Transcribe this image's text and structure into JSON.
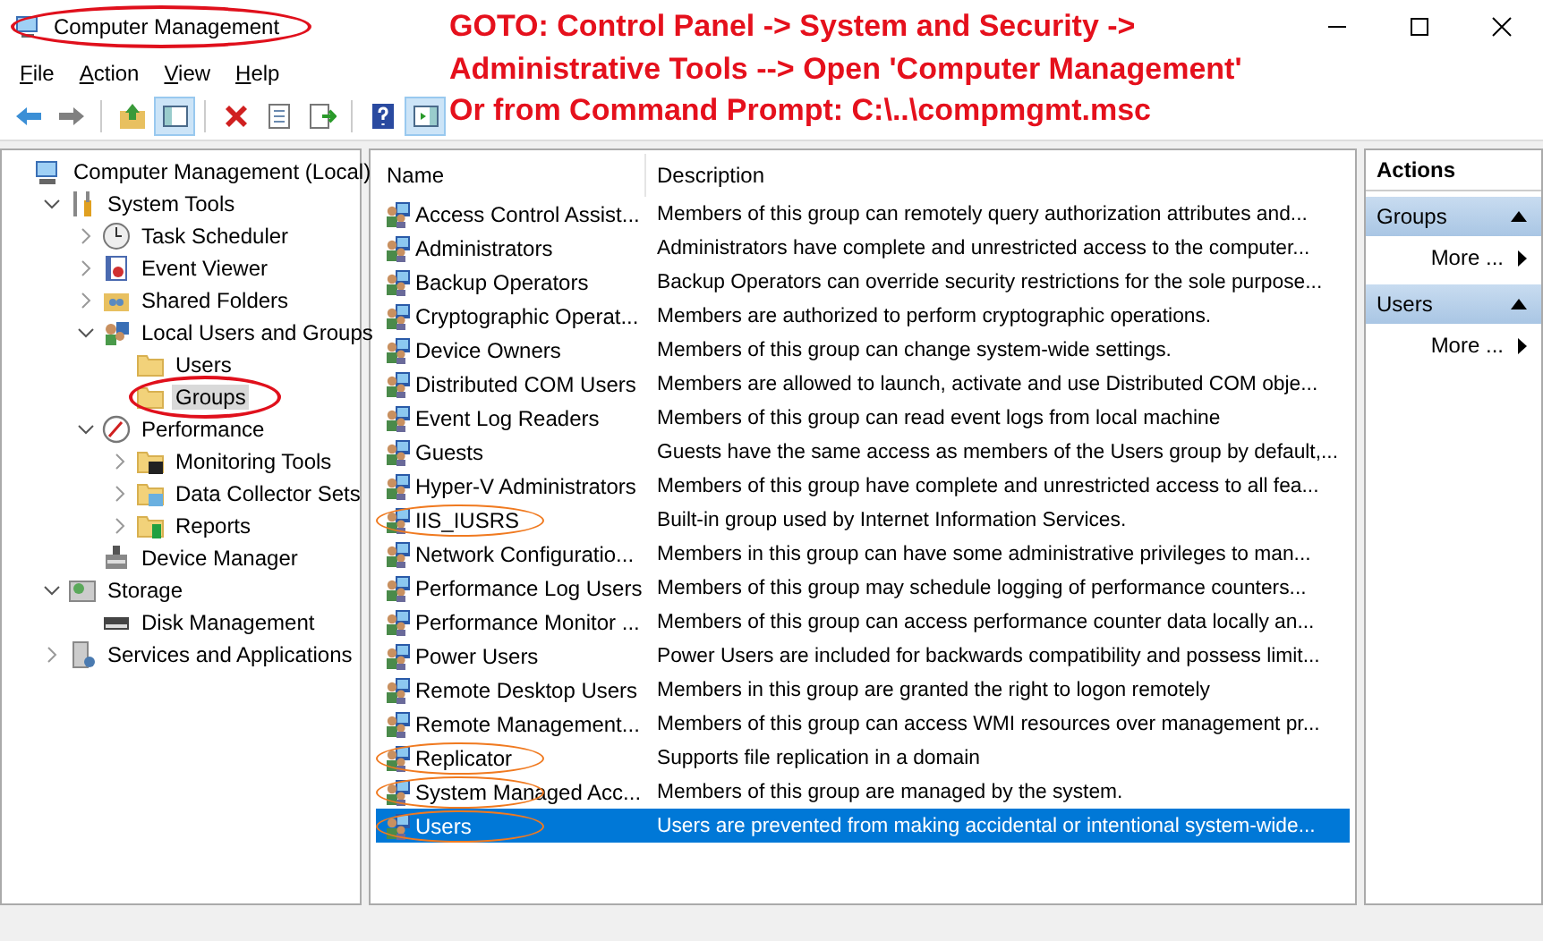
{
  "window": {
    "title": "Computer Management",
    "title_circled": true
  },
  "annotation": {
    "lines": [
      "GOTO: Control Panel -> System and Security ->",
      "Administrative Tools --> Open 'Computer Management'",
      "Or from Command Prompt: C:\\..\\compmgmt.msc"
    ]
  },
  "menu": [
    "File",
    "Action",
    "View",
    "Help"
  ],
  "toolbar": [
    {
      "kind": "back"
    },
    {
      "kind": "forward"
    },
    {
      "kind": "separator"
    },
    {
      "kind": "up"
    },
    {
      "kind": "tree-toggle",
      "pressed": true
    },
    {
      "kind": "separator"
    },
    {
      "kind": "delete"
    },
    {
      "kind": "properties"
    },
    {
      "kind": "export"
    },
    {
      "kind": "separator"
    },
    {
      "kind": "help"
    },
    {
      "kind": "action-pane",
      "pressed": true
    }
  ],
  "tree": [
    {
      "label": "Computer Management (Local)",
      "kind": "computer",
      "selected": false,
      "circled": false,
      "children": [
        {
          "label": "System Tools",
          "kind": "tools",
          "expanded": true,
          "selected": false,
          "circled": false,
          "children": [
            {
              "label": "Task Scheduler",
              "kind": "clock",
              "expanded": false,
              "selected": false,
              "circled": false
            },
            {
              "label": "Event Viewer",
              "kind": "log",
              "expanded": false,
              "selected": false,
              "circled": false
            },
            {
              "label": "Shared Folders",
              "kind": "share",
              "expanded": false,
              "selected": false,
              "circled": false
            },
            {
              "label": "Local Users and Groups",
              "kind": "users",
              "expanded": true,
              "selected": false,
              "circled": false,
              "children": [
                {
                  "label": "Users",
                  "kind": "folder",
                  "selected": false,
                  "circled": false
                },
                {
                  "label": "Groups",
                  "kind": "folder",
                  "selected": true,
                  "circled": true
                }
              ]
            },
            {
              "label": "Performance",
              "kind": "perf",
              "expanded": true,
              "selected": false,
              "circled": false,
              "children": [
                {
                  "label": "Monitoring Tools",
                  "kind": "folder-monitor",
                  "expanded": false,
                  "selected": false,
                  "circled": false
                },
                {
                  "label": "Data Collector Sets",
                  "kind": "folder-data",
                  "expanded": false,
                  "selected": false,
                  "circled": false
                },
                {
                  "label": "Reports",
                  "kind": "folder-report",
                  "expanded": false,
                  "selected": false,
                  "circled": false
                }
              ]
            },
            {
              "label": "Device Manager",
              "kind": "device",
              "selected": false,
              "circled": false
            }
          ]
        },
        {
          "label": "Storage",
          "kind": "storage",
          "expanded": true,
          "selected": false,
          "circled": false,
          "children": [
            {
              "label": "Disk Management",
              "kind": "disk",
              "selected": false,
              "circled": false
            }
          ]
        },
        {
          "label": "Services and Applications",
          "kind": "services",
          "expanded": false,
          "selected": false,
          "circled": false
        }
      ]
    }
  ],
  "table": {
    "columns": [
      "Name",
      "Description"
    ],
    "rows": [
      {
        "name": "Access Control Assist...",
        "description": "Members of this group can remotely query authorization attributes and...",
        "selected": false,
        "circled": false
      },
      {
        "name": "Administrators",
        "description": "Administrators have complete and unrestricted access to the computer...",
        "selected": false,
        "circled": false
      },
      {
        "name": "Backup Operators",
        "description": "Backup Operators can override security restrictions for the sole purpose...",
        "selected": false,
        "circled": false
      },
      {
        "name": "Cryptographic Operat...",
        "description": "Members are authorized to perform cryptographic operations.",
        "selected": false,
        "circled": false
      },
      {
        "name": "Device Owners",
        "description": "Members of this group can change system-wide settings.",
        "selected": false,
        "circled": false
      },
      {
        "name": "Distributed COM Users",
        "description": "Members are allowed to launch, activate and use Distributed COM obje...",
        "selected": false,
        "circled": false
      },
      {
        "name": "Event Log Readers",
        "description": "Members of this group can read event logs from local machine",
        "selected": false,
        "circled": false
      },
      {
        "name": "Guests",
        "description": "Guests have the same access as members of the Users group by default,...",
        "selected": false,
        "circled": false
      },
      {
        "name": "Hyper-V Administrators",
        "description": "Members of this group have complete and unrestricted access to all fea...",
        "selected": false,
        "circled": false
      },
      {
        "name": "IIS_IUSRS",
        "description": "Built-in group used by Internet Information Services.",
        "selected": false,
        "circled": true
      },
      {
        "name": "Network Configuratio...",
        "description": "Members in this group can have some administrative privileges to man...",
        "selected": false,
        "circled": false
      },
      {
        "name": "Performance Log Users",
        "description": "Members of this group may schedule logging of performance counters...",
        "selected": false,
        "circled": false
      },
      {
        "name": "Performance Monitor ...",
        "description": "Members of this group can access performance counter data locally an...",
        "selected": false,
        "circled": false
      },
      {
        "name": "Power Users",
        "description": "Power Users are included for backwards compatibility and possess limit...",
        "selected": false,
        "circled": false
      },
      {
        "name": "Remote Desktop Users",
        "description": "Members in this group are granted the right to logon remotely",
        "selected": false,
        "circled": false
      },
      {
        "name": "Remote Management...",
        "description": "Members of this group can access WMI resources over management pr...",
        "selected": false,
        "circled": false
      },
      {
        "name": "Replicator",
        "description": "Supports file replication in a domain",
        "selected": false,
        "circled": true
      },
      {
        "name": "System Managed Acc...",
        "description": "Members of this group are managed by the system.",
        "selected": false,
        "circled": true
      },
      {
        "name": "Users",
        "description": "Users are prevented from making accidental or intentional system-wide...",
        "selected": true,
        "circled": true
      }
    ]
  },
  "actions": {
    "title": "Actions",
    "sections": [
      {
        "title": "Groups",
        "items": [
          "More ..."
        ]
      },
      {
        "title": "Users",
        "items": [
          "More ..."
        ]
      }
    ]
  }
}
